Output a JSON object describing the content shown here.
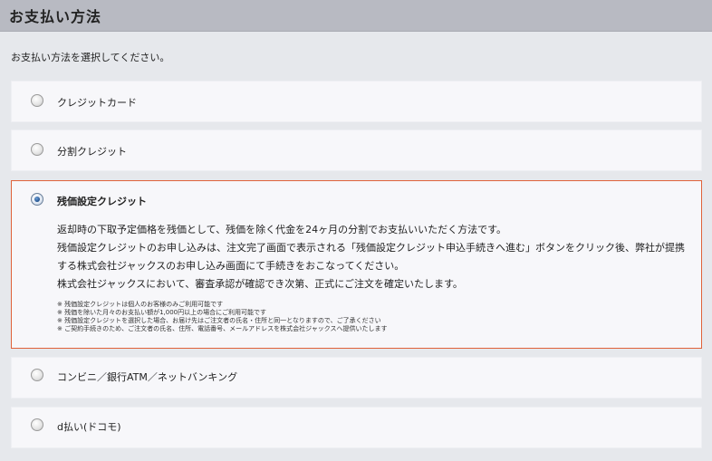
{
  "header": {
    "title": "お支払い方法"
  },
  "instruction": "お支払い方法を選択してください。",
  "options": [
    {
      "label": "クレジットカード",
      "selected": false
    },
    {
      "label": "分割クレジット",
      "selected": false
    },
    {
      "label": "残価設定クレジット",
      "selected": true,
      "description": [
        "返却時の下取予定価格を残価として、残価を除く代金を24ヶ月の分割でお支払いいただく方法です。",
        "残価設定クレジットのお申し込みは、注文完了画面で表示される「残価設定クレジット申込手続きへ進む」ボタンをクリック後、弊社が提携",
        "する株式会社ジャックスのお申し込み画面にて手続きをおこなってください。",
        "株式会社ジャックスにおいて、審査承認が確認でき次第、正式にご注文を確定いたします。"
      ],
      "notes": [
        "※ 残価設定クレジットは個人のお客様のみご利用可能です",
        "※ 残価を除いた月々のお支払い額が1,000円以上の場合にご利用可能です",
        "※ 残価設定クレジットを選択した場合、お届け先はご注文者の氏名・住所と同一となりますので、ご了承ください",
        "※ ご契約手続きのため、ご注文者の氏名、住所、電話番号、メールアドレスを株式会社ジャックスへ提供いたします"
      ]
    },
    {
      "label": "コンビニ／銀行ATM／ネットバンキング",
      "selected": false
    },
    {
      "label": "d払い(ドコモ)",
      "selected": false
    }
  ],
  "colors": {
    "header_bg": "#b8bac2",
    "page_bg": "#e6e8ec",
    "card_bg": "#f7f7fa",
    "selected_border": "#e0623a"
  }
}
